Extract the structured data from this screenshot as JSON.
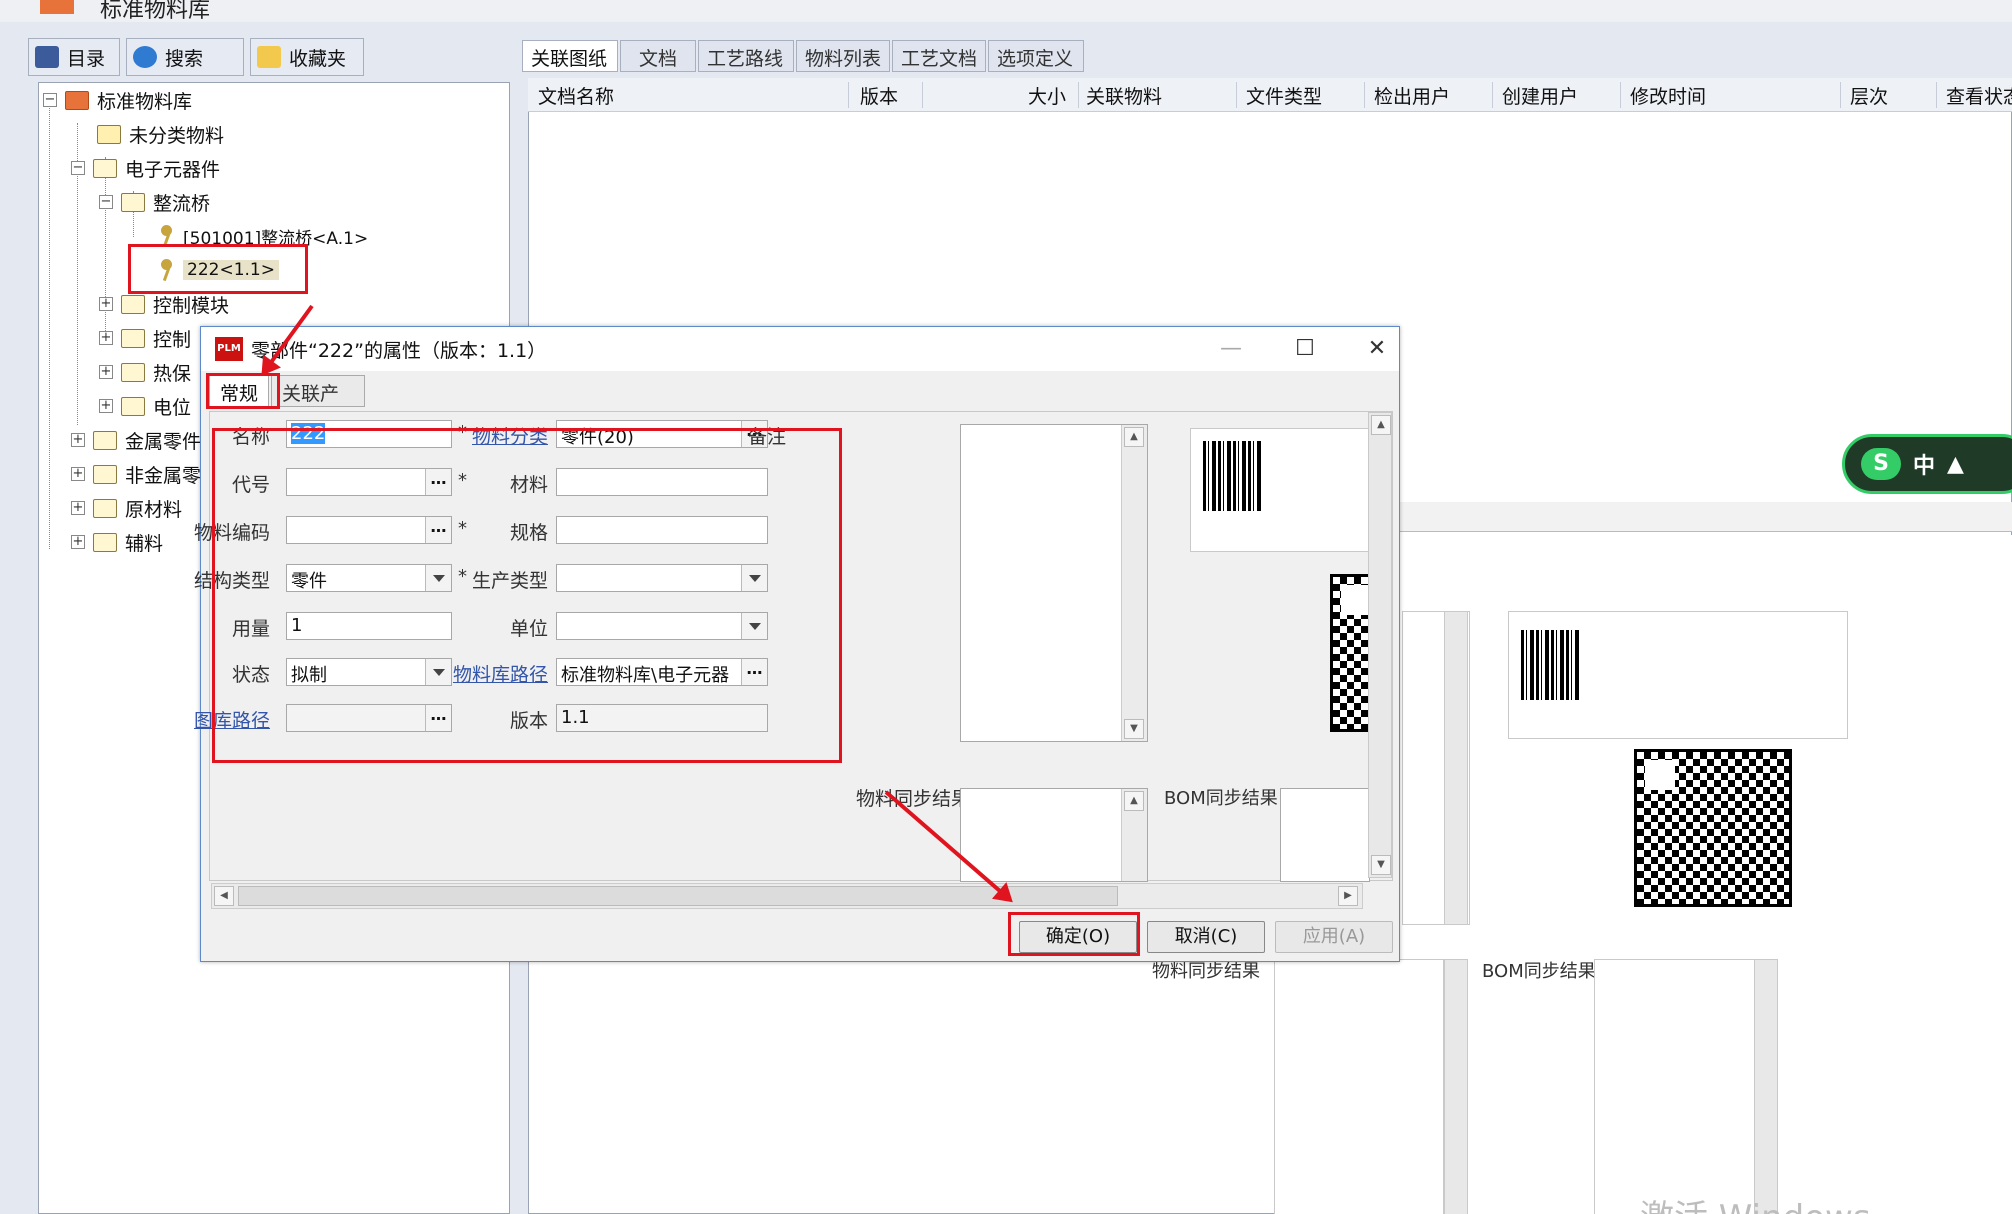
{
  "app": {
    "title": "标准物料库"
  },
  "left_tabs": [
    {
      "label": "目录",
      "icon": "catalog-icon"
    },
    {
      "label": "搜索",
      "icon": "search-icon"
    },
    {
      "label": "收藏夹",
      "icon": "favorites-icon"
    }
  ],
  "tree": {
    "root": "标准物料库",
    "unclassified": "未分类物料",
    "electronic": "电子元器件",
    "rectifier": "整流桥",
    "part_a": "[501001]整流桥<A.1>",
    "part_b": "222<1.1>",
    "control_module": "控制模块",
    "control2": "控制",
    "thermal": "热保",
    "potentiometer": "电位",
    "metal": "金属零件",
    "nonmetal": "非金属零",
    "raw": "原材料",
    "aux": "辅料"
  },
  "right_tabs": [
    "关联图纸",
    "文档",
    "工艺路线",
    "物料列表",
    "工艺文档",
    "选项定义"
  ],
  "grid_columns": [
    "文档名称",
    "版本",
    "大小",
    "关联物料",
    "文件类型",
    "检出用户",
    "创建用户",
    "修改时间",
    "层次",
    "查看状态"
  ],
  "background": {
    "material_sync": "物料同步结果",
    "bom_sync": "BOM同步结果"
  },
  "ime": {
    "label": "中"
  },
  "watermark": "激活 Windows",
  "dialog": {
    "title": "零部件“222”的属性（版本：1.1）",
    "tabs": [
      "常规",
      "关联产品"
    ],
    "fields": {
      "name_label": "名称",
      "name_value": "222",
      "code_label": "代号",
      "code_value": "",
      "matcode_label": "物料编码",
      "matcode_value": "",
      "struct_label": "结构类型",
      "struct_value": "零件",
      "qty_label": "用量",
      "qty_value": "1",
      "status_label": "状态",
      "status_value": "拟制",
      "libpath_label": "图库路径",
      "libpath_value": "",
      "category_label": "物料分类",
      "category_value": "零件(20)",
      "material_label": "材料",
      "material_value": "",
      "spec_label": "规格",
      "spec_value": "",
      "prodtype_label": "生产类型",
      "prodtype_value": "",
      "unit_label": "单位",
      "unit_value": "",
      "matlibpath_label": "物料库路径",
      "matlibpath_value": "标准物料库\\电子元器",
      "version_label": "版本",
      "version_value": "1.1",
      "remark_label": "备注",
      "material_sync_label": "物料同步结果",
      "bom_sync_label": "BOM同步结果",
      "required_mark": "*"
    },
    "buttons": {
      "ok": "确定(O)",
      "cancel": "取消(C)",
      "apply": "应用(A)"
    }
  }
}
